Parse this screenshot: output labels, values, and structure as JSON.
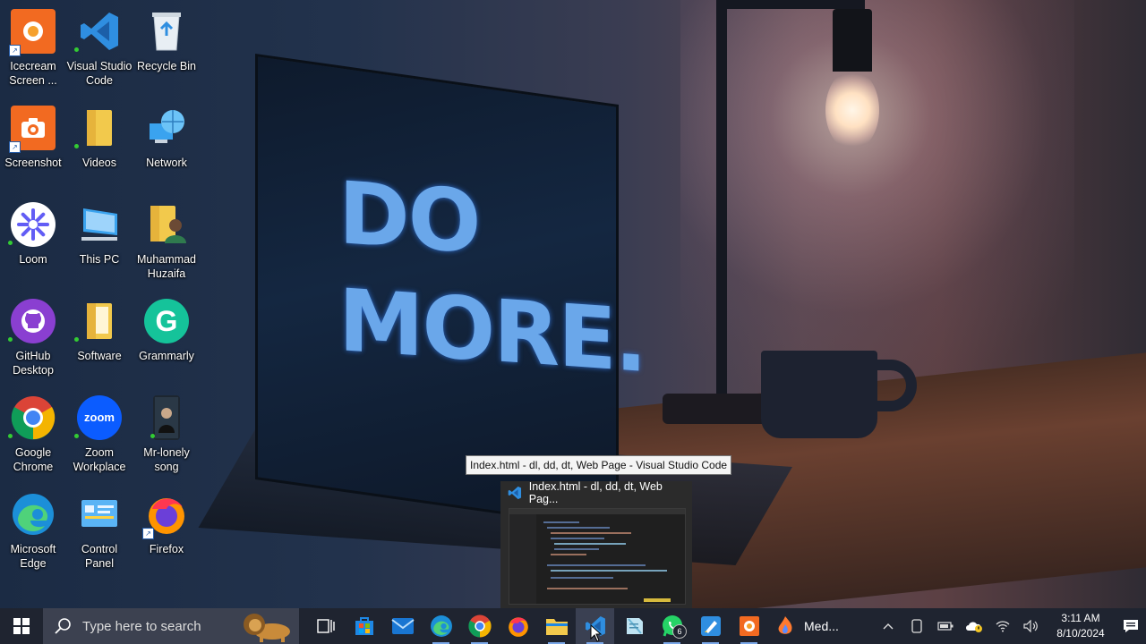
{
  "wallpaper": {
    "line1": "DO",
    "line2": "MORE."
  },
  "desktop_icons": [
    {
      "id": "icecream",
      "label": "Icecream Screen ...",
      "icon": "icecream-screen-recorder-icon",
      "shortcut": true
    },
    {
      "id": "vscode",
      "label": "Visual Studio Code",
      "icon": "vscode-icon",
      "shortcut": false
    },
    {
      "id": "recycle",
      "label": "Recycle Bin",
      "icon": "recycle-bin-icon",
      "shortcut": false
    },
    {
      "id": "screenshot",
      "label": "Screenshot",
      "icon": "screenshot-app-icon",
      "shortcut": true
    },
    {
      "id": "videos",
      "label": "Videos",
      "icon": "folder-icon",
      "shortcut": false
    },
    {
      "id": "network",
      "label": "Network",
      "icon": "network-globe-icon",
      "shortcut": false
    },
    {
      "id": "loom",
      "label": "Loom",
      "icon": "loom-icon",
      "shortcut": false
    },
    {
      "id": "thispc",
      "label": "This PC",
      "icon": "computer-icon",
      "shortcut": false
    },
    {
      "id": "huzaifa",
      "label": "Muhammad Huzaifa",
      "icon": "user-folder-icon",
      "shortcut": false
    },
    {
      "id": "github",
      "label": "GitHub Desktop",
      "icon": "github-desktop-icon",
      "shortcut": false
    },
    {
      "id": "software",
      "label": "Software",
      "icon": "folder-icon",
      "shortcut": false
    },
    {
      "id": "grammarly",
      "label": "Grammarly",
      "icon": "grammarly-icon",
      "shortcut": false
    },
    {
      "id": "chrome",
      "label": "Google Chrome",
      "icon": "chrome-icon",
      "shortcut": false
    },
    {
      "id": "zoom",
      "label": "Zoom Workplace",
      "icon": "zoom-icon",
      "icon_text": "zoom",
      "shortcut": false
    },
    {
      "id": "mrlonely",
      "label": "Mr-lonely song",
      "icon": "video-file-icon",
      "shortcut": false
    },
    {
      "id": "edge",
      "label": "Microsoft Edge",
      "icon": "edge-icon",
      "shortcut": false
    },
    {
      "id": "controlpanel",
      "label": "Control Panel",
      "icon": "control-panel-icon",
      "shortcut": false
    },
    {
      "id": "firefox",
      "label": "Firefox",
      "icon": "firefox-icon",
      "shortcut": true
    }
  ],
  "tooltip": {
    "text": "Index.html - dl, dd, dt, Web Page - Visual Studio Code"
  },
  "preview": {
    "title": "Index.html - dl, dd, dt, Web Pag..."
  },
  "taskbar": {
    "search_placeholder": "Type here to search",
    "apps": [
      {
        "id": "taskview",
        "icon": "task-view-icon"
      },
      {
        "id": "store",
        "icon": "microsoft-store-icon"
      },
      {
        "id": "mail",
        "icon": "mail-icon"
      },
      {
        "id": "edge",
        "icon": "edge-icon"
      },
      {
        "id": "chrome",
        "icon": "chrome-icon"
      },
      {
        "id": "firefox",
        "icon": "firefox-icon"
      },
      {
        "id": "explorer",
        "icon": "file-explorer-icon"
      },
      {
        "id": "vscode",
        "icon": "vscode-icon",
        "active": true
      },
      {
        "id": "notepad",
        "icon": "notepad-icon"
      },
      {
        "id": "whatsapp",
        "icon": "whatsapp-icon",
        "badge": "6"
      },
      {
        "id": "paint",
        "icon": "paint-icon"
      },
      {
        "id": "icecream",
        "icon": "icecream-screen-recorder-icon"
      }
    ],
    "media_label": "Med...",
    "time": "3:11 AM",
    "date": "8/10/2024"
  },
  "colors": {
    "taskbar": "#1f2430",
    "accent": "#7aa7e8",
    "vscode_blue": "#2f8ee0"
  }
}
